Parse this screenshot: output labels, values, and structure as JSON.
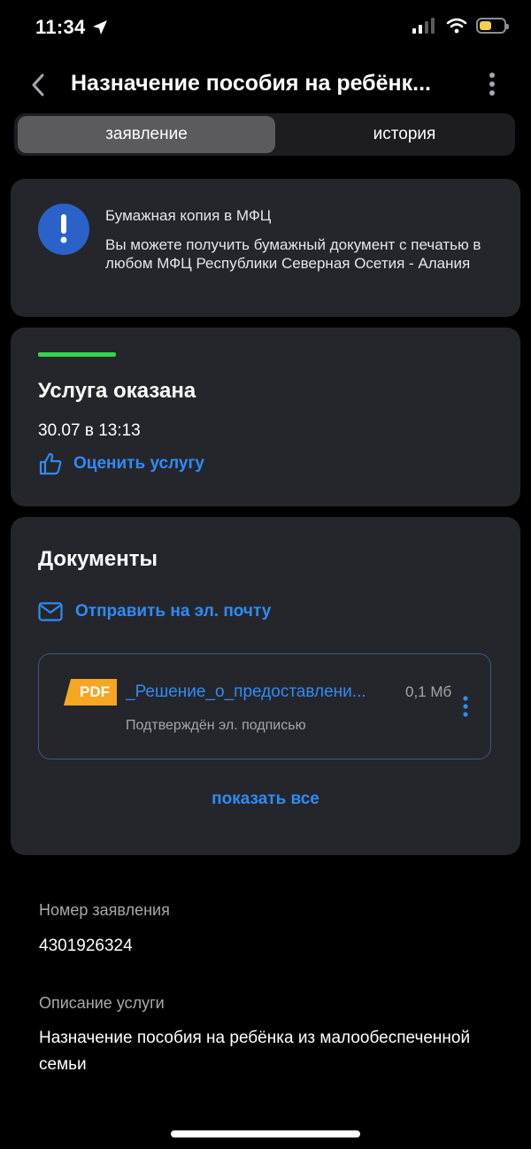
{
  "status_bar": {
    "time": "11:34",
    "battery_color": "#f5d04a"
  },
  "header": {
    "title": "Назначение пособия на ребёнк...",
    "back_icon": "chevron-left-icon",
    "more_icon": "more-vertical-icon"
  },
  "tabs": [
    {
      "label": "заявление",
      "active": true
    },
    {
      "label": "история",
      "active": false
    }
  ],
  "info_card": {
    "icon": "exclamation-icon",
    "title": "Бумажная копия в МФЦ",
    "text": "Вы можете получить бумажный документ с печатью в любом МФЦ Республики Северная Осетия - Алания"
  },
  "status_card": {
    "title": "Услуга оказана",
    "date": "30.07 в 13:13",
    "rate_label": "Оценить услугу",
    "progress_color": "#32d74b"
  },
  "documents": {
    "title": "Документы",
    "email_label": "Отправить на эл. почту",
    "file": {
      "badge": "PDF",
      "name": "_Решение_о_предоставлени...",
      "size": "0,1 Мб",
      "signature": "Подтверждён эл. подписью"
    },
    "show_all_label": "показать все"
  },
  "details": {
    "number_label": "Номер заявления",
    "number_value": "4301926324",
    "description_label": "Описание услуги",
    "description_value": "Назначение пособия на ребёнка из малообеспеченной семьи"
  },
  "colors": {
    "accent": "#2e8cf6",
    "card_bg": "#25262b",
    "pdf_badge": "#f5a623"
  }
}
